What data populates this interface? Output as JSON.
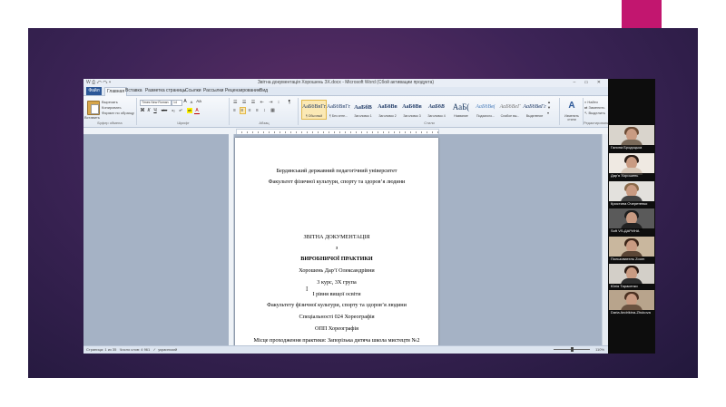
{
  "slide": {
    "accent_color": "#c2166f",
    "background_color": "#3d2457"
  },
  "word": {
    "window_title": "Звітна документація Хорошень ЗХ.docx  -  Microsoft Word (Сбой активации продукта)",
    "quick_access": "W ⎙ ↶ ↷ ▾",
    "window_controls": "– ▭ ✕",
    "tabs": {
      "file": "Файл",
      "home": "Главная",
      "insert": "Вставка",
      "page_layout": "Разметка страницы",
      "references": "Ссылки",
      "mailings": "Рассылки",
      "review": "Рецензирование",
      "view": "Вид"
    },
    "ribbon": {
      "clipboard": {
        "paste": "Вставить",
        "cut": "Вырезать",
        "copy": "Копировать",
        "format_painter": "Формат по образцу",
        "label": "Буфер обмена"
      },
      "font": {
        "family": "Times New Roman",
        "size": "14",
        "grow": "A",
        "shrink": "A",
        "bold": "Ж",
        "italic": "К",
        "underline": "Ч",
        "strike": "abc",
        "subscript": "x₂",
        "superscript": "x²",
        "color": "A",
        "highlight": "ab",
        "case": "Aa",
        "label": "Шрифт"
      },
      "paragraph": {
        "label": "Абзац",
        "pilcrow": "¶"
      },
      "styles": {
        "label": "Стили",
        "items": [
          {
            "sample": "АаБбВвГг,",
            "name": "¶ Обычный"
          },
          {
            "sample": "АаБбВвГг,",
            "name": "¶ Без инте..."
          },
          {
            "sample": "АаБбВ",
            "name": "Заголовок 1"
          },
          {
            "sample": "АаБбВв",
            "name": "Заголовок 2"
          },
          {
            "sample": "АаБбВв",
            "name": "Заголовок 3"
          },
          {
            "sample": "АаБбВ",
            "name": "Заголовок 4"
          },
          {
            "sample": "АаБ(",
            "name": "Название"
          },
          {
            "sample": "АаБбВв(",
            "name": "Подзаголо..."
          },
          {
            "sample": "АаБбВеГ",
            "name": "Слабое вы..."
          },
          {
            "sample": "АаБбВвГг",
            "name": "Выделение"
          }
        ],
        "change": "Изменить стили"
      },
      "editing": {
        "find": "Найти",
        "replace": "Заменить",
        "select": "Выделить",
        "label": "Редактирование"
      }
    },
    "document": {
      "lines": [
        "Бердянський державний педагогічний університет",
        "Факультет фізичної культури, спорту та здоров’я людини",
        "ЗВІТНА ДОКУМЕНТАЦІЯ",
        "з",
        "ВИРОБНИЧОЇ ПРАКТИКИ",
        "Хорошень Дар’ї Олександрівни",
        "3 курс, 3Х група",
        "І рівня вищої освіти",
        "Факультету фізичної культури, спорту та здоров’я людини",
        "Спеціальності 024 Хореографія",
        "ОПП Хореографія",
        "Місце проходження практики: Запорізька дитяча школа мистецтв №2"
      ]
    },
    "statusbar": {
      "page": "Страница: 1 из 35",
      "words": "Число слов: 4 961",
      "language": "украинский",
      "zoom": "110%"
    }
  },
  "participants": [
    {
      "name": "Галина Бродоцька"
    },
    {
      "name": "Дар’я Хорошень"
    },
    {
      "name": "Кристина Очеретенко"
    },
    {
      "name": "Soft VS-ДАРИНА"
    },
    {
      "name": "Пользователь Zoom"
    },
    {
      "name": "Юлія Тарасенко"
    },
    {
      "name": "Daria Andrikina-Zhukova"
    }
  ]
}
